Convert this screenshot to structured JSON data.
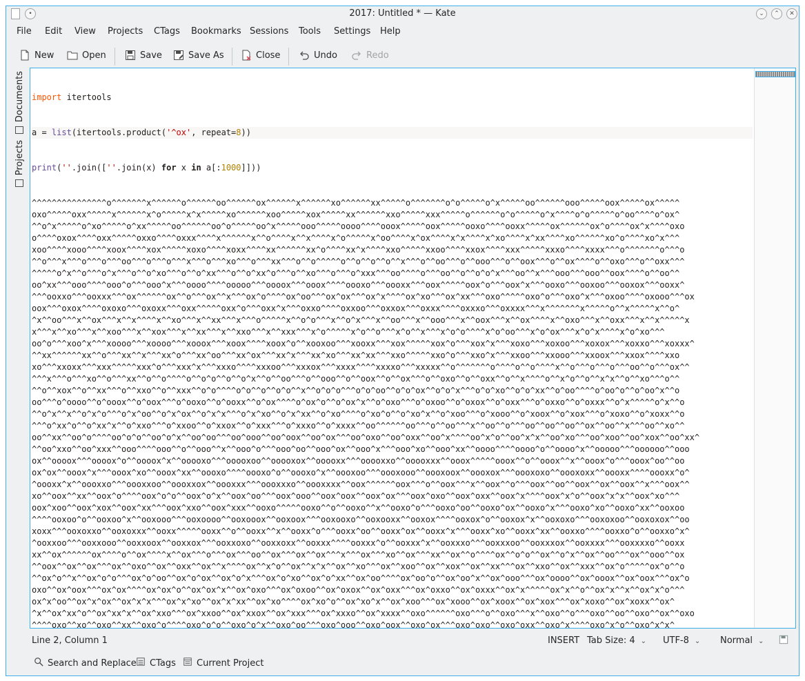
{
  "window": {
    "title": "2017: Untitled * — Kate"
  },
  "menu": [
    "File",
    "Edit",
    "View",
    "Projects",
    "CTags",
    "Bookmarks",
    "Sessions",
    "Tools",
    "Settings",
    "Help"
  ],
  "toolbar": {
    "new_label": "New",
    "open_label": "Open",
    "save_label": "Save",
    "save_as_label": "Save As",
    "close_label": "Close",
    "undo_label": "Undo",
    "redo_label": "Redo"
  },
  "sidebar": {
    "documents_label": "Documents",
    "projects_label": "Projects"
  },
  "editor": {
    "code_lines": [
      "import itertools",
      "a = list(itertools.product('^ox', repeat=8))",
      "print(''.join([''.join(x) for x in a[:1000]]))"
    ],
    "output_lines": [
      "^^^^^^^^^^^^^^^o^^^^^^^x^^^^^^o^^^^^^oo^^^^^^ox^^^^^^x^^^^^^xo^^^^^^xx^^^^^o^^^^^^^o^o^^^^^o^x^^^^^oo^^^^^^ooo^^^^^oox^^^^^ox^^^^^",
      "oxo^^^^^oxx^^^^^x^^^^^^x^o^^^^^x^x^^^^^xo^^^^^^xoo^^^^^xox^^^^^xx^^^^^^xxo^^^^^xxx^^^^^o^^^^^^o^o^^^^^o^x^^^^o^o^^^^^o^oo^^^^o^ox^",
      "^^o^x^^^^^o^xo^^^^^o^xx^^^^^oo^^^^^^oo^o^^^^^oo^x^^^^^ooo^^^^^oooo^^^^ooox^^^^^oox^^^^^ooxo^^^^ooxx^^^^^ox^^^^^^ox^o^^^^ox^x^^^^oxo",
      "o^^^^oxox^^^^oxx^^^^^oxxo^^^^oxxx^^^^x^^^^^^x^^o^^^^x^^x^^^^x^o^^^^^x^oo^^^^x^ox^^^^x^x^^^^x^xo^^^^x^xx^^^^xo^^^^^^xo^o^^^^xo^x^^^",
      "xoo^^^^xooo^^^^xoox^^^^xox^^^^^xoxo^^^^xoxx^^^^xx^^^^^^xx^o^^^^xx^x^^^^xxo^^^^^xxoo^^^^xxox^^^^xxx^^^^^xxxo^^^^xxxx^^^o^^^^^^^o^^^o",
      "^^o^^^x^^^o^^^o^^^oo^^^o^^^o^^^x^^^o^^^xo^^^o^^^xx^^^o^^o^^^^^o^^o^^o^^o^^x^^^o^^oo^^^o^^ooo^^^o^^oox^^^o^^ox^^^^o^^oxo^^^o^^oxx^^^",
      "^^^^^o^x^^o^^^o^x^^^o^^o^xo^^^o^^o^xx^^^o^^o^xx^o^^^o^^xo^^^o^^^o^xxx^^^oo^^^^o^^^oo^^o^^o^o^x^^^oo^^x^^^ooo^^^ooo^^oox^^^^o^^oo^^",
      "oo^xx^^^ooo^^^^ooo^o^^^ooo^x^^^oooo^^^^ooooo^^^oooox^^^ooox^^^^oooxo^^^oooxx^^^oox^^^^^oox^o^^^oox^x^^^ooxo^^^ooxoo^^^ooxox^^^ooxx^",
      "^^^ooxxo^^^ooxxx^^^ox^^^^^^ox^^o^^^ox^^x^^^ox^o^^^^ox^oo^^^ox^ox^^^ox^x^^^^ox^xo^^^ox^xx^^^oxo^^^^^oxo^o^^^oxo^x^^^oxoo^^^^oxooo^^^ox",
      "oox^^^oxox^^^^oxoxo^^^oxoxx^^^oxx^^^^^oxx^o^^^oxx^x^^^oxxo^^^^oxxoo^^^oxxox^^^oxxx^^^^oxxxo^^^oxxxx^^^x^^^^^^^x^^^^^o^^x^^^^^x^^o^",
      "^x^^oo^^^x^^ox^^^x^^x^^^^x^^xo^^^x^^xx^^^x^^^o^^^^^x^^o^o^^^x^^o^x^^^x^^oo^^^x^^ooo^^^x^^oox^^^x^^ox^^^^x^^oxo^^^x^^oxx^^^x^^x^^^^^x",
      "x^^^x^^xo^^^x^^xoo^^^x^^xox^^^x^^xx^^^x^^xxo^^^x^^xxx^^^x^o^^^^^x^o^^o^^^x^o^^x^^^x^o^o^^^^x^o^oo^^^x^o^ox^^^x^o^x^^^^x^o^xo^^^",
      "oo^o^^^xoo^x^^^xoooo^^^xoooo^^^xooox^^^xoox^^^^xoox^o^^xooxoo^^^xooxx^^^xox^^^^^xox^o^^^xox^x^^^xoxo^^^xoxoo^^^xoxox^^^xoxxo^^^xoxxx^",
      "^^xx^^^^^^xx^^o^^^xx^^x^^^xx^o^^^xx^oo^^^xx^ox^^^xx^x^^^xx^xo^^^xx^xx^^^xxo^^^^^xxo^o^^^xxo^x^^^xxoo^^^xxooo^^^xxoox^^^xxox^^^^xxo",
      "xo^^^xxoxx^^^xxx^^^^^xxx^o^^^xxx^x^^^xxxo^^^^xxxoo^^^xxxox^^^xxxx^^^^xxxxo^^^xxxxx^^o^^^^^^^o^^^^o^^o^^^^x^^o^^^o^^^o^^^oo^^o^^^ox^^",
      "^^^x^^^o^^^xo^^o^^^xx^^o^^o^^^^o^^o^o^^o^^o^x^^o^^oo^^^o^^ooo^^o^^oox^^o^^ox^^^o^^oxo^^o^^oxx^^o^^x^^^^o^^x^o^^o^^x^x^^o^^xo^^^o^^",
      "^^o^^xox^^o^^xx^^^o^^xxo^^o^^xxx^^o^o^^^^o^o^^o^^o^o^^x^^o^o^o^^^o^o^oo^^o^o^ox^^o^o^x^^^o^o^xo^^o^o^xx^^o^oo^^^^o^oo^o^^o^oo^x^^o",
      "oo^^^o^oooo^^o^ooox^^o^oox^^^o^ooxo^^o^ooxx^^o^ox^^^^o^ox^o^^o^ox^x^^o^oxo^^^o^oxoo^^o^oxox^^o^oxx^^^o^oxxo^^o^oxxx^^o^x^^^^^o^x^^o",
      "^^o^x^^x^^o^x^o^^^o^x^oo^^o^x^ox^^o^x^x^^^o^x^xo^^o^x^xx^^o^xo^^^^o^xo^o^^o^xo^x^^o^xoo^^^o^xooo^^o^xoox^^o^xox^^^o^xoxo^^o^xoxx^^o",
      "^^^o^xx^o^^o^xx^x^^o^xxo^^^o^xxoo^^o^xxox^^o^xxx^^^o^xxxo^^o^xxxx^^oo^^^^^^oo^^^o^^oo^^^x^^oo^^o^^^oo^^oo^^oo^^ox^^oo^^x^^^oo^^xo^^",
      "oo^^xx^^oo^o^^^^oo^o^o^^oo^o^x^^oo^oo^^^oo^ooo^^oo^oox^^oo^ox^^^oo^oxo^^oo^oxx^^oo^x^^^^oo^x^o^^oo^x^x^^oo^xo^^^oo^xoo^^oo^xox^^oo^xx^",
      "^^oo^xxo^^oo^xxx^^ooo^^^^ooo^^o^^ooo^^x^^ooo^o^^^ooo^oo^^ooo^ox^^ooo^x^^^ooo^xo^^ooo^xx^^oooo^^^^oooo^o^^oooo^x^^ooooo^^^oooooo^^ooo",
      "ox^^oooox^^^oooox^o^^oooox^x^^ooooxo^^^ooooxoo^^ooooxox^^ooooxx^^^ooooxxo^^ooooxxx^^ooox^^^^^ooox^^o^^ooox^^x^^ooox^o^^^ooox^oo^^oo",
      "ox^ox^^ooox^x^^^ooox^xo^^ooox^xx^^oooxo^^^^oooxo^o^^oooxo^x^^oooxoo^^^oooxooo^^oooxoox^^oooxox^^^oooxoxo^^oooxoxx^^oooxx^^^^oooxx^o^",
      "^oooxx^x^^oooxxo^^^oooxxoo^^oooxxox^^oooxxx^^^oooxxxo^^oooxxxx^^oox^^^^^^oox^^^o^^oox^^^x^^oox^^o^^^oox^^oo^^oox^^ox^^oox^^x^^^oox^^",
      "xo^^oox^^xx^^oox^o^^^^oox^o^o^^oox^o^x^^oox^oo^^^oox^ooo^^oox^oox^^oox^ox^^^oox^oxo^^oox^oxx^^oox^x^^^^oox^x^o^^oox^x^x^^oox^xo^^^",
      "oox^xoo^^oox^xox^^oox^xx^^^oox^xxo^^oox^xxx^^ooxo^^^^^ooxo^^o^^ooxo^^x^^ooxo^o^^^ooxo^oo^^ooxo^ox^^ooxo^x^^^ooxo^xo^^ooxo^xx^^ooxoo",
      "^^^^ooxoo^o^^ooxoo^x^^ooxooo^^^ooxoooo^^ooxooox^^ooxoox^^^ooxooxo^^ooxooxx^^ooxox^^^^ooxox^o^^ooxox^x^^ooxoxo^^^ooxoxoo^^ooxoxox^^oo",
      "xoxx^^^ooxoxxo^^ooxoxxx^^ooxx^^^^^ooxx^^o^^ooxx^^x^^ooxx^o^^^ooxx^oo^^ooxx^ox^^ooxx^x^^^ooxx^xo^^ooxx^xx^^ooxxo^^^^ooxxo^o^^ooxxo^x^",
      "^ooxxoo^^^ooxxooo^^ooxxoox^^ooxxox^^^ooxxoxo^^ooxxoxx^^ooxxx^^^^ooxxx^o^^ooxxx^x^^ooxxxo^^^ooxxxoo^^ooxxxox^^ooxxxx^^^ooxxxxo^^ooxx",
      "xx^^ox^^^^^^ox^^^^o^^ox^^^^x^^ox^^^o^^^ox^^^oo^^ox^^^ox^^ox^^^x^^^ox^^^xo^^ox^^^xx^^ox^^o^^^^ox^^o^o^^ox^^o^x^^ox^^oo^^^ox^^ooo^^ox",
      "^^oox^^ox^^ox^^^ox^^oxo^^ox^^oxx^^ox^^x^^^^ox^^x^o^^ox^^x^x^^ox^^xo^^^ox^^xoo^^ox^^xox^^ox^^xx^^^ox^^xxo^^ox^^xxx^^ox^o^^^^^ox^o^^o",
      "^^ox^o^^x^^ox^o^o^^^ox^o^oo^^ox^o^ox^^ox^o^x^^^ox^o^xo^^ox^o^xx^^ox^oo^^^^ox^oo^o^^ox^oo^x^^ox^ooo^^^ox^oooo^^ox^ooox^^ox^oox^^^ox^o",
      "oxo^^ox^oox^^^ox^ox^^^^ox^ox^o^^ox^ox^x^^ox^oxo^^^ox^oxoo^^ox^oxox^^ox^oxx^^^ox^oxxo^^ox^oxxx^^ox^x^^^^^ox^x^^o^^ox^x^^x^^ox^x^o^^^",
      "ox^x^oo^^ox^x^ox^^ox^x^x^^^ox^x^xo^^ox^x^xx^^ox^xo^^^^ox^xo^o^^ox^xo^x^^ox^xoo^^^ox^xooo^^ox^xoox^^ox^xox^^^ox^xoxo^^ox^xoxx^^ox^",
      "^x^^ox^xx^o^^ox^xx^x^^ox^xxo^^^ox^xxoo^^ox^xxox^^ox^xxx^^^ox^xxxo^^ox^xxxx^^oxo^^^^^^oxo^^^o^^oxo^^^x^^oxo^^o^^^oxo^^oo^^oxo^^ox^^oxo",
      "^^^^oxo^^xo^^oxo^^xx^^oxo^o^^^^oxo^o^o^^oxo^o^x^^oxo^oo^^^oxo^ooo^^oxo^oox^^oxo^ox^^^oxo^oxo^^oxo^oxx^^oxo^x^^^^oxo^x^o^^oxo^x^x^",
      "^oxo^xo^^^oxo^xoo^^oxo^xox^^oxo^xx^^^oxo^xxo^^oxo^xxx^^oxoo^^^^^oxoo^^o^^oxoo^^x^^oxoo^o^^^oxoo^oo^^oxoo^ox^^oxoo^x^^^oxoo^xo^^oxoo",
      "^^xxxxoo^^^xxxxoox^^xxxxox^^^xxxxoxo^^xxxxoxx^^xxxxx^^^^xxxxx^o^^xxxxx^x^^xxxxxo^^^xxxxxoo^^xxxxxox^^xxxxxx^^^xxxxxxo^^o^^^^^o^^o^^",
      "x^^^x^o^^^o^^o^oo^^^^o^^o^o^^o^^x^^^^o^^xo^^^o^^xx^^o^o^^^^^o^o^^o^^o^o^^x^^o^o^o^^^o^o^oo^^o^o^ox^^o^o^x^^^o^o^xo^^o^o^xx^^o^oo^^^"
    ]
  },
  "status": {
    "position": "Line 2, Column 1",
    "mode": "INSERT",
    "tab_size": "Tab Size: 4",
    "encoding": "UTF-8",
    "highlight_mode": "Normal"
  },
  "bottom": {
    "search_label": "Search and Replace",
    "ctags_label": "CTags",
    "project_label": "Current Project"
  }
}
